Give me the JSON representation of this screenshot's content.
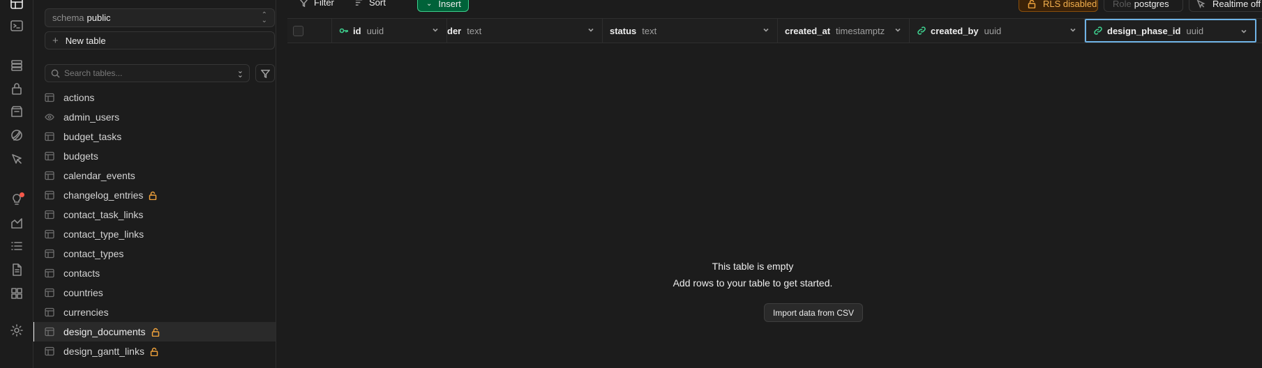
{
  "rail": {
    "icons": [
      "table-editor-icon",
      "sql-editor-icon",
      "database-icon",
      "auth-icon",
      "storage-icon",
      "edge-functions-icon",
      "realtime-icon",
      "advisors-icon",
      "reports-icon",
      "logs-icon",
      "api-docs-icon",
      "integrations-icon",
      "settings-icon"
    ]
  },
  "sidebar": {
    "schema_label": "schema",
    "schema_value": "public",
    "new_table_label": "New table",
    "search_placeholder": "Search tables...",
    "tables": [
      {
        "name": "actions",
        "icon": "table-icon",
        "locked": false
      },
      {
        "name": "admin_users",
        "icon": "view-icon",
        "locked": false
      },
      {
        "name": "budget_tasks",
        "icon": "table-icon",
        "locked": false
      },
      {
        "name": "budgets",
        "icon": "table-icon",
        "locked": false
      },
      {
        "name": "calendar_events",
        "icon": "table-icon",
        "locked": false
      },
      {
        "name": "changelog_entries",
        "icon": "table-icon",
        "locked": true
      },
      {
        "name": "contact_task_links",
        "icon": "table-icon",
        "locked": false
      },
      {
        "name": "contact_type_links",
        "icon": "table-icon",
        "locked": false
      },
      {
        "name": "contact_types",
        "icon": "table-icon",
        "locked": false
      },
      {
        "name": "contacts",
        "icon": "table-icon",
        "locked": false
      },
      {
        "name": "countries",
        "icon": "table-icon",
        "locked": false
      },
      {
        "name": "currencies",
        "icon": "table-icon",
        "locked": false
      },
      {
        "name": "design_documents",
        "icon": "table-icon",
        "locked": true,
        "selected": true
      },
      {
        "name": "design_gantt_links",
        "icon": "table-icon",
        "locked": true
      }
    ]
  },
  "toolbar": {
    "filter_label": "Filter",
    "sort_label": "Sort",
    "insert_label": "Insert",
    "rls_label": "RLS disabled",
    "role_key": "Role",
    "role_value": "postgres",
    "realtime_label": "Realtime off"
  },
  "columns": [
    {
      "name": "id",
      "type": "uuid",
      "icon": "key-icon"
    },
    {
      "name": "der",
      "type": "text",
      "icon": ""
    },
    {
      "name": "status",
      "type": "text",
      "icon": ""
    },
    {
      "name": "created_at",
      "type": "timestamptz",
      "icon": ""
    },
    {
      "name": "created_by",
      "type": "uuid",
      "icon": "link-icon"
    },
    {
      "name": "design_phase_id",
      "type": "uuid",
      "icon": "link-icon"
    }
  ],
  "empty_state": {
    "title": "This table is empty",
    "subtitle": "Add rows to your table to get started.",
    "import_label": "Import data from CSV"
  },
  "colors": {
    "accent_green": "#3ecf8e",
    "warning": "#f0a23b",
    "focus": "#6fb3e6"
  }
}
